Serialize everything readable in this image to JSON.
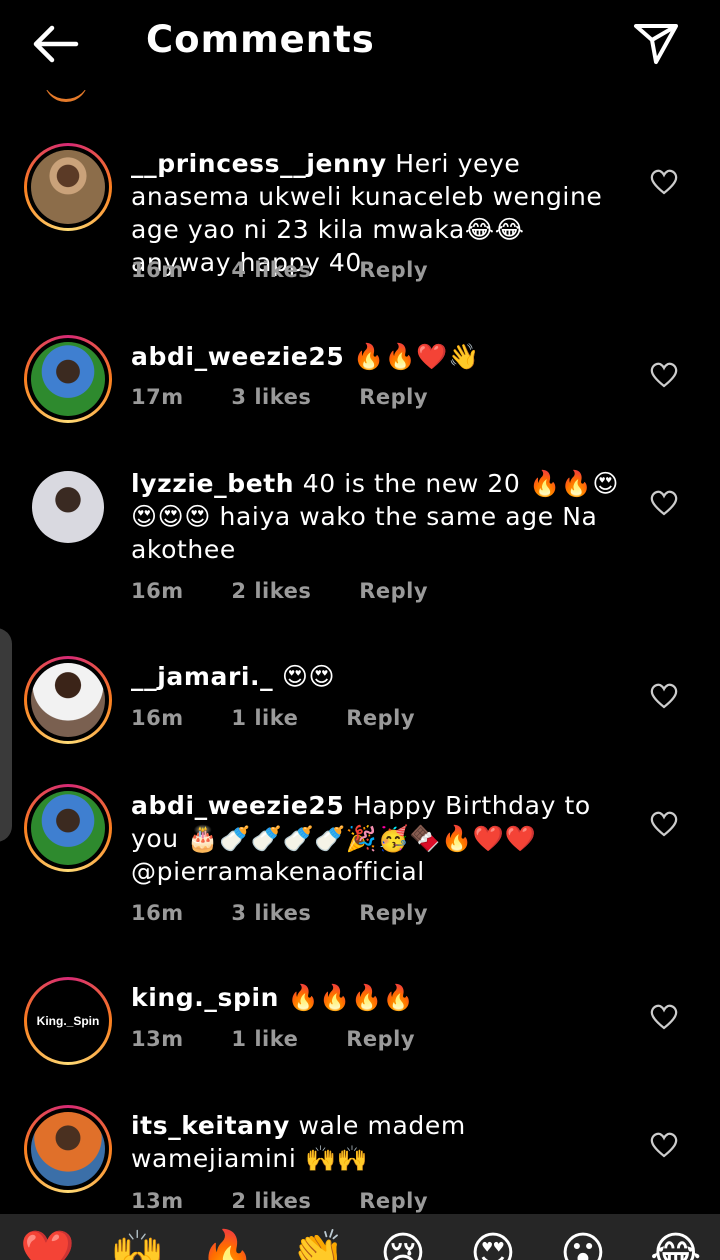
{
  "header": {
    "title": "Comments"
  },
  "comments": [
    {
      "username": "__princess__jenny",
      "text": "Heri yeye anasema ukweli kunaceleb wengine age yao ni 23 kila mwaka😂😂 anyway happy 40",
      "time": "16m",
      "likes": "4 likes",
      "reply": "Reply"
    },
    {
      "username": "abdi_weezie25",
      "text": "🔥🔥❤️👋",
      "time": "17m",
      "likes": "3 likes",
      "reply": "Reply"
    },
    {
      "username": "lyzzie_beth",
      "text": "40 is the new 20 🔥🔥😍😍😍😍 haiya wako the same age Na akothee",
      "time": "16m",
      "likes": "2 likes",
      "reply": "Reply"
    },
    {
      "username": "__jamari._",
      "text": "😍😍",
      "time": "16m",
      "likes": "1 like",
      "reply": "Reply"
    },
    {
      "username": "abdi_weezie25",
      "text": "Happy Birthday to you 🎂🍼🍼🍼🍼🎉🥳🍫🔥❤️❤️ @pierramakenaofficial",
      "time": "16m",
      "likes": "3 likes",
      "reply": "Reply"
    },
    {
      "username": "king._spin",
      "text": "🔥🔥🔥🔥",
      "time": "13m",
      "likes": "1 like",
      "reply": "Reply",
      "avatar_text": "King._Spin"
    },
    {
      "username": "its_keitany",
      "text": "wale madem wamejiamini 🙌🙌",
      "time": "13m",
      "likes": "2 likes",
      "reply": "Reply"
    }
  ],
  "emoji_bar": [
    "❤️",
    "🙌",
    "🔥",
    "👏",
    "😢",
    "😍",
    "😮",
    "😂"
  ],
  "colors": {
    "background": "#000000",
    "meta_gray": "#9a9a9a",
    "story_ring": "#e1306c"
  }
}
